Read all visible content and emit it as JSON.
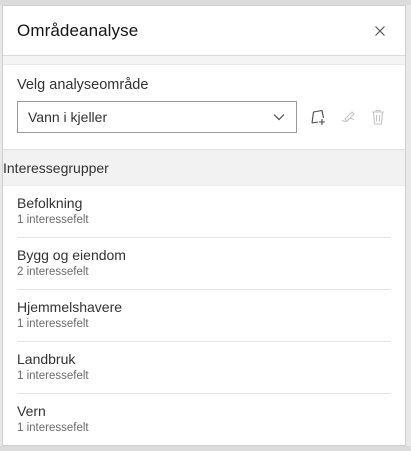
{
  "panel": {
    "title": "Områdeanalyse",
    "close_icon": "close-icon"
  },
  "area": {
    "label": "Velg analyseområde",
    "selected": "Vann i kjeller",
    "tools": [
      "add-area-icon",
      "edit-area-icon",
      "trash-icon"
    ]
  },
  "groups": {
    "header": "Interessegrupper",
    "items": [
      {
        "name": "Befolkning",
        "count": "1 interessefelt"
      },
      {
        "name": "Bygg og eiendom",
        "count": "2 interessefelt"
      },
      {
        "name": "Hjemmelshavere",
        "count": "1 interessefelt"
      },
      {
        "name": "Landbruk",
        "count": "1 interessefelt"
      },
      {
        "name": "Vern",
        "count": "1 interessefelt"
      }
    ]
  },
  "colors": {
    "text": "#323232",
    "icon_disabled": "#c4c4c4",
    "band": "#f2f2f2"
  }
}
